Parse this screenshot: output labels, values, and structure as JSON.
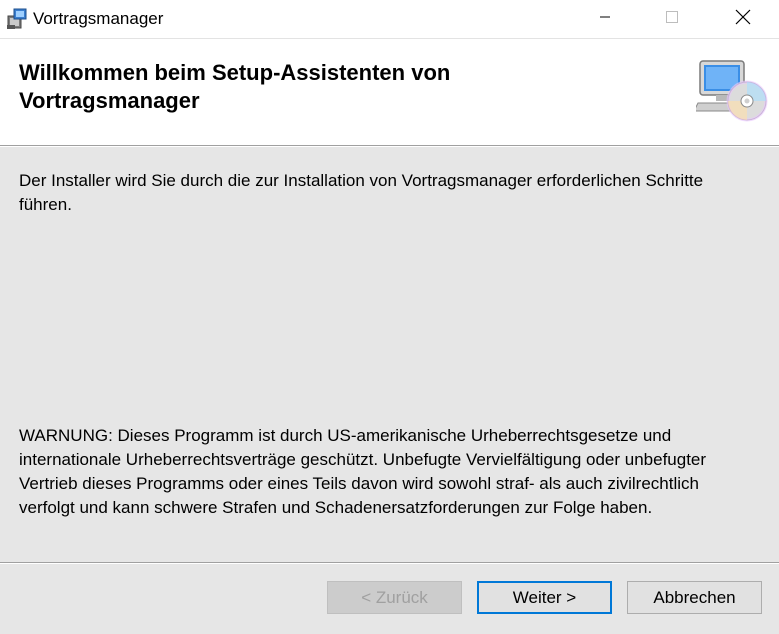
{
  "window": {
    "title": "Vortragsmanager",
    "icons": [
      "installer-app-icon",
      "minimize-icon",
      "maximize-icon",
      "close-icon"
    ]
  },
  "header": {
    "title": "Willkommen beim Setup-Assistenten von Vortragsmanager",
    "graphic": "computer-with-cd-icon"
  },
  "main": {
    "intro": "Der Installer wird Sie durch die zur Installation von Vortragsmanager erforderlichen Schritte führen.",
    "warning": "WARNUNG: Dieses Programm ist durch US-amerikanische Urheberrechtsgesetze und internationale Urheberrechtsverträge geschützt. Unbefugte Vervielfältigung oder unbefugter Vertrieb dieses Programms oder eines Teils davon wird sowohl straf- als auch zivilrechtlich verfolgt und kann schwere Strafen und Schadenersatzforderungen zur Folge haben."
  },
  "footer": {
    "back_label": "< Zurück",
    "next_label": "Weiter >",
    "cancel_label": "Abbrechen"
  },
  "colors": {
    "panel_bg": "#e6e6e6",
    "focus_border": "#0078d7",
    "disabled_text": "#a0a0a0"
  }
}
